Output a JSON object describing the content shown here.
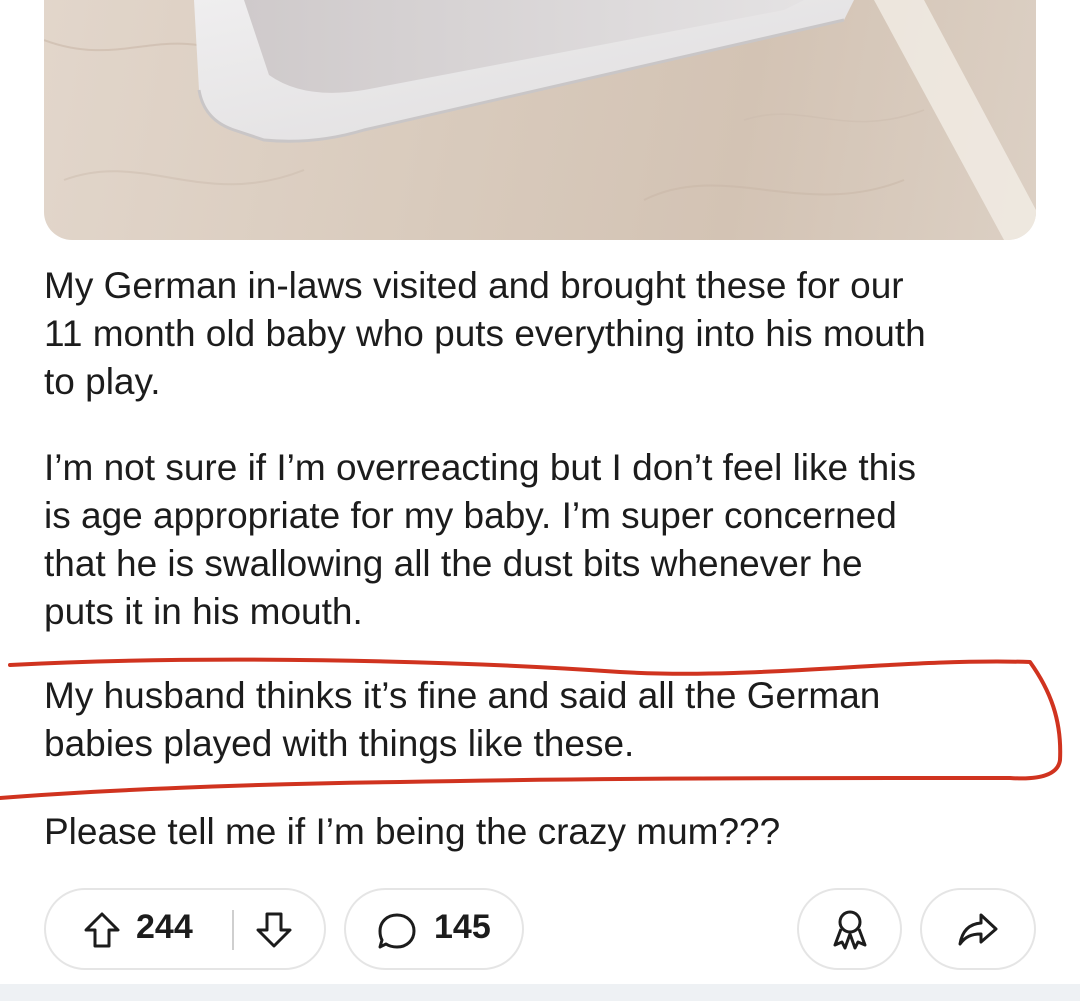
{
  "post": {
    "body": {
      "paragraph1": {
        "line1": "My German in-laws visited and brought these for our",
        "line2": "11 month old baby who puts everything into his mouth",
        "line3": "to play."
      },
      "paragraph2": {
        "line1": "I’m not sure if I’m overreacting but I don’t feel like this",
        "line2": "is age appropriate for my baby. I’m super concerned",
        "line3": "that he is swallowing all the dust bits whenever he",
        "line4": "puts it in his mouth."
      },
      "paragraph3": {
        "line1": "My husband thinks it’s fine and said all the German",
        "line2": "babies played with things like these."
      },
      "paragraph4": {
        "line1": "Please tell me if I’m being the crazy mum???"
      }
    }
  },
  "actions": {
    "upvotes": "244",
    "comments": "145"
  },
  "colors": {
    "annotation": "#d0331f",
    "pill_border": "#e5e5e5",
    "text": "#1c1c1c"
  },
  "icons": {
    "upvote": "upvote-arrow-icon",
    "downvote": "downvote-arrow-icon",
    "comment": "comment-bubble-icon",
    "award": "award-icon",
    "share": "share-arrow-icon"
  }
}
